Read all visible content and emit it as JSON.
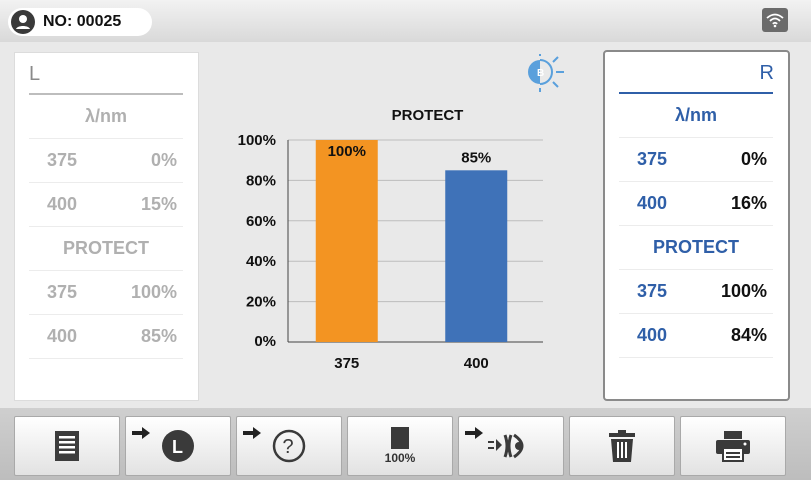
{
  "header": {
    "record_label": "NO: 00025",
    "wifi_icon": "wifi-icon",
    "user_icon": "user-icon"
  },
  "left": {
    "side": "L",
    "unit": "λ/nm",
    "rows": [
      {
        "wl": "375",
        "val": "0%"
      },
      {
        "wl": "400",
        "val": "15%"
      }
    ],
    "protect_label": "PROTECT",
    "protect_rows": [
      {
        "wl": "375",
        "val": "100%"
      },
      {
        "wl": "400",
        "val": "85%"
      }
    ]
  },
  "right": {
    "side": "R",
    "unit": "λ/nm",
    "rows": [
      {
        "wl": "375",
        "val": "0%"
      },
      {
        "wl": "400",
        "val": "16%"
      }
    ],
    "protect_label": "PROTECT",
    "protect_rows": [
      {
        "wl": "375",
        "val": "100%"
      },
      {
        "wl": "400",
        "val": "84%"
      }
    ]
  },
  "mode_icon": {
    "name": "blue-light-icon",
    "letter": "B"
  },
  "chart_data": {
    "type": "bar",
    "title": "PROTECT",
    "categories": [
      "375",
      "400"
    ],
    "values": [
      100,
      85
    ],
    "data_labels": [
      "100%",
      "85%"
    ],
    "colors": [
      "#f39422",
      "#3f72b8"
    ],
    "ylim": [
      0,
      100
    ],
    "yticks": [
      "0%",
      "20%",
      "40%",
      "60%",
      "80%",
      "100%"
    ],
    "grid": true,
    "xlabel": "",
    "ylabel": ""
  },
  "toolbar": {
    "buttons": [
      {
        "name": "list-icon"
      },
      {
        "name": "left-lens-icon",
        "letter": "L"
      },
      {
        "name": "help-icon",
        "symbol": "?"
      },
      {
        "name": "transmittance-icon",
        "label": "100%"
      },
      {
        "name": "eye-lens-icon"
      },
      {
        "name": "trash-icon"
      },
      {
        "name": "printer-icon"
      }
    ]
  }
}
